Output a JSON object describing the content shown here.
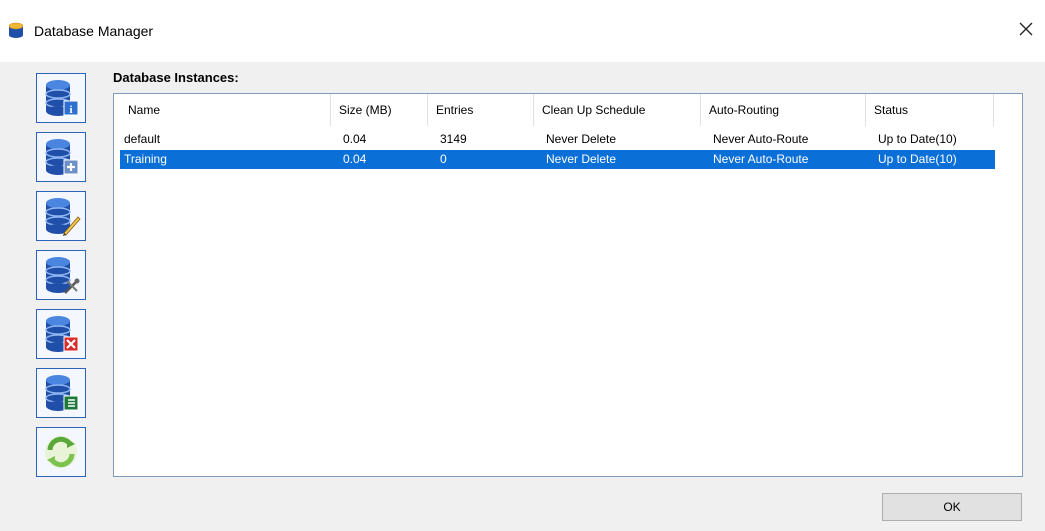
{
  "window": {
    "title": "Database Manager",
    "icon": "database-icon",
    "close_icon": "close-icon"
  },
  "sidebar": {
    "buttons": [
      {
        "name": "database-info-button",
        "icon": "database-info-icon"
      },
      {
        "name": "database-add-button",
        "icon": "database-add-icon"
      },
      {
        "name": "database-edit-button",
        "icon": "database-edit-icon"
      },
      {
        "name": "database-tools-button",
        "icon": "database-tools-icon"
      },
      {
        "name": "database-delete-button",
        "icon": "database-delete-icon"
      },
      {
        "name": "database-excel-button",
        "icon": "database-excel-icon"
      },
      {
        "name": "refresh-button",
        "icon": "refresh-icon"
      }
    ]
  },
  "main": {
    "section_label": "Database Instances:",
    "table": {
      "columns": [
        "Name",
        "Size (MB)",
        "Entries",
        "Clean Up Schedule",
        "Auto-Routing",
        "Status"
      ],
      "rows": [
        [
          "default",
          "0.04",
          "3149",
          "Never Delete",
          "Never Auto-Route",
          "Up to Date(10)"
        ],
        [
          "Training",
          "0.04",
          "0",
          "Never Delete",
          "Never Auto-Route",
          "Up to Date(10)"
        ]
      ],
      "selected_row_index": 1
    }
  },
  "footer": {
    "ok_label": "OK"
  },
  "colors": {
    "selection": "#0a6fd7",
    "button_border": "#2c62b8",
    "db_blue": "#1f4fa8"
  }
}
